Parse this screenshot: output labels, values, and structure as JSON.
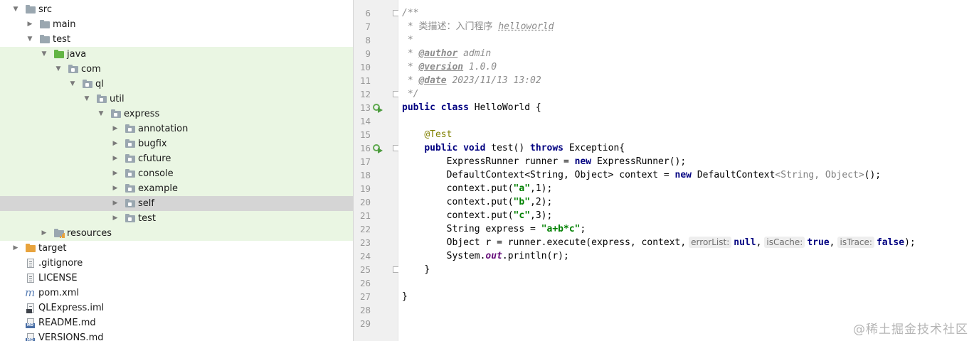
{
  "project_tree": {
    "src": "src",
    "main": "main",
    "test": "test",
    "java": "java",
    "com": "com",
    "ql": "ql",
    "util": "util",
    "express": "express",
    "packages": [
      "annotation",
      "bugfix",
      "cfuture",
      "console",
      "example",
      "self",
      "test"
    ],
    "resources": "resources",
    "target": "target",
    "files": [
      ".gitignore",
      "LICENSE",
      "pom.xml",
      "QLExpress.iml",
      "README.md",
      "VERSIONS.md"
    ]
  },
  "editor": {
    "line_numbers": [
      "6",
      "7",
      "8",
      "9",
      "10",
      "11",
      "12",
      "13",
      "14",
      "15",
      "16",
      "17",
      "18",
      "19",
      "20",
      "21",
      "22",
      "23",
      "24",
      "25",
      "26",
      "27",
      "28",
      "29"
    ],
    "doc": {
      "open": "/**",
      "desc_prefix": " * 类描述：入门程序 ",
      "desc_word": "helloworld",
      "blank": " *",
      "star": " * ",
      "author_tag": "@author",
      "author_value": " admin",
      "version_tag": "@version",
      "version_value": " 1.0.0",
      "date_tag": "@date",
      "date_value": " 2023/11/13 13:02",
      "close": " */"
    },
    "kw_public": "public",
    "kw_class": "class",
    "class_decl": " HelloWorld {",
    "annotation_test": "@Test",
    "kw_void": "void",
    "method_name": " test() ",
    "kw_throws": "throws",
    "exception_decl": " Exception{",
    "l18_a": "ExpressRunner runner = ",
    "kw_new": "new",
    "l18_b": " ExpressRunner();",
    "l19_a": "DefaultContext<String, Object> context = ",
    "l19_b": " DefaultContext",
    "l19_generic": "<String, Object>",
    "l19_c": "();",
    "put_prefix": "context.put(",
    "str_a": "\"a\"",
    "num_1": ",1);",
    "str_b": "\"b\"",
    "num_2": ",2);",
    "str_c": "\"c\"",
    "num_3": ",3);",
    "l23_a": "String express = ",
    "l23_str": "\"a+b*c\"",
    "l23_b": ";",
    "l24_a": "Object r = runner.execute(express, context,",
    "hint_errorList": "errorList:",
    "kw_null": "null",
    "hint_isCache": "isCache:",
    "kw_true": "true",
    "hint_isTrace": "isTrace:",
    "kw_false": "false",
    "l24_end": ");",
    "comma": ",",
    "l25_a": "System.",
    "l25_out": "out",
    "l25_b": ".println(r);",
    "close_brace": "}"
  },
  "watermark": "@稀土掘金技术社区",
  "colors": {
    "tree_highlight": "#eaf6e3",
    "tree_selected": "#d5d5d5",
    "caret_line": "#fcfae6",
    "keyword": "#000080",
    "string": "#008000",
    "number": "#0000ff",
    "annotation": "#808000",
    "comment": "#8c8c8c"
  },
  "icons": [
    "chevron-down-icon",
    "chevron-right-icon",
    "folder-icon",
    "package-icon",
    "file-icon",
    "maven-icon",
    "markdown-icon",
    "run-gutter-icon",
    "fold-icon"
  ]
}
